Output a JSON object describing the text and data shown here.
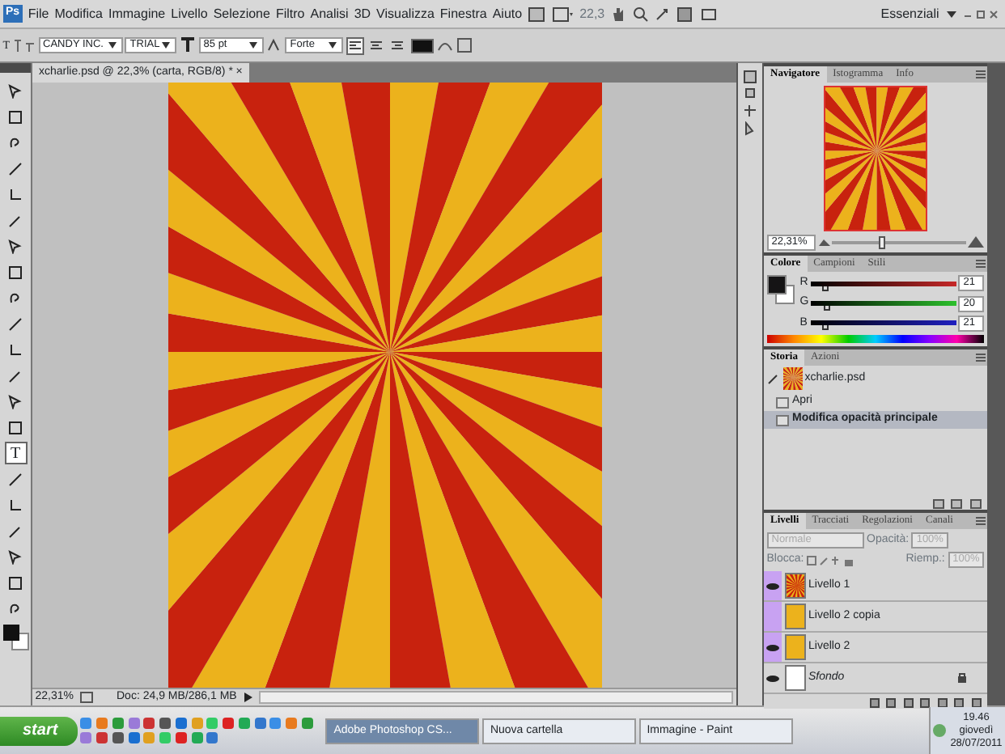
{
  "menu_bar": {
    "logo": "Ps",
    "menus": [
      "File",
      "Modifica",
      "Immagine",
      "Livello",
      "Selezione",
      "Filtro",
      "Analisi",
      "3D",
      "Visualizza",
      "Finestra",
      "Aiuto"
    ],
    "zoom": "22,3",
    "workspace": "Essenziali"
  },
  "options_bar": {
    "tool": "T",
    "font_family": "CANDY INC.",
    "font_style": "TRIAL",
    "font_size": "85 pt",
    "antialias": "Forte",
    "alignment": [
      {
        "selected": true
      },
      {
        "selected": false
      },
      {
        "selected": false
      }
    ]
  },
  "tools": [
    {
      "selected": false
    },
    {
      "selected": false
    },
    {
      "selected": false
    },
    {
      "selected": false
    },
    {
      "selected": false
    },
    {
      "selected": false
    },
    {
      "selected": false
    },
    {
      "selected": false
    },
    {
      "selected": false
    },
    {
      "selected": false
    },
    {
      "selected": false
    },
    {
      "selected": false
    },
    {
      "selected": false
    },
    {
      "selected": false
    },
    {
      "label": "T",
      "selected": true
    },
    {
      "selected": false
    },
    {
      "selected": false
    },
    {
      "selected": false
    },
    {
      "selected": false
    },
    {
      "selected": false
    },
    {
      "selected": false
    }
  ],
  "document": {
    "tab_title": "xcharlie.psd @ 22,3% (carta, RGB/8) *",
    "close": "×",
    "zoom": "22,31%",
    "doc_info": "Doc: 24,9 MB/286,1 MB"
  },
  "navigator": {
    "tabs": [
      {
        "label": "Navigatore",
        "selected": true
      },
      {
        "label": "Istogramma",
        "selected": false
      },
      {
        "label": "Info",
        "selected": false
      }
    ],
    "zoom": "22,31%",
    "level": 0.35
  },
  "color": {
    "tabs": [
      {
        "label": "Colore",
        "selected": true
      },
      {
        "label": "Campioni",
        "selected": false
      },
      {
        "label": "Stili",
        "selected": false
      }
    ],
    "channels": [
      {
        "name": "R",
        "value": "21",
        "level": 0.08
      },
      {
        "name": "G",
        "value": "20",
        "level": 0.08
      },
      {
        "name": "B",
        "value": "21",
        "level": 0.08
      }
    ]
  },
  "history": {
    "tabs": [
      {
        "label": "Storia",
        "selected": true
      },
      {
        "label": "Azioni",
        "selected": false
      }
    ],
    "snapshot": "xcharlie.psd",
    "items": [
      {
        "label": "Apri",
        "selected": false
      },
      {
        "label": "Modifica opacità principale",
        "selected": true
      }
    ]
  },
  "layers": {
    "tabs": [
      {
        "label": "Livelli",
        "selected": true
      },
      {
        "label": "Tracciati",
        "selected": false
      },
      {
        "label": "Regolazioni",
        "selected": false
      },
      {
        "label": "Canali",
        "selected": false
      }
    ],
    "blend_mode": "Normale",
    "opacity_label": "Opacità:",
    "opacity": "100%",
    "lock_label": "Blocca:",
    "fill_label": "Riemp.:",
    "fill": "100%",
    "items": [
      {
        "name": "Livello 1",
        "kind": "sunburst",
        "visible": true,
        "color": "#c8a2f2",
        "locked": false
      },
      {
        "name": "Livello 2 copia",
        "kind": "yellow",
        "visible": false,
        "color": "#c8a2f2",
        "locked": false
      },
      {
        "name": "Livello 2",
        "kind": "yellow",
        "visible": true,
        "color": "#c8a2f2",
        "locked": false
      },
      {
        "name": "Sfondo",
        "kind": "white",
        "visible": true,
        "locked": true
      }
    ]
  },
  "taskbar": {
    "start": "start",
    "tasks": [
      {
        "label": "Adobe Photoshop CS...",
        "selected": true
      },
      {
        "label": "Nuova cartella",
        "selected": false
      },
      {
        "label": "Immagine - Paint",
        "selected": false
      }
    ],
    "time": "19.46",
    "day": "giovedì",
    "date": "28/07/2011"
  }
}
